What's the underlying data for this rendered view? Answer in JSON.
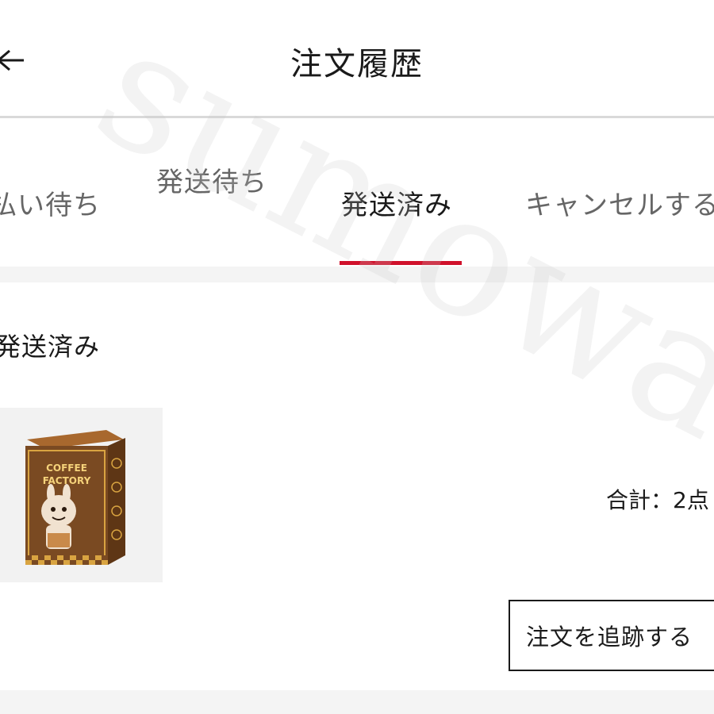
{
  "header": {
    "title": "注文履歴",
    "back_icon": "arrow-left-icon"
  },
  "tabs": [
    {
      "label": "支払い待ち",
      "visible_text": "払い待ち",
      "active": false
    },
    {
      "label": "発送待ち",
      "active": false
    },
    {
      "label": "発送済み",
      "active": true
    },
    {
      "label": "キャンセルする",
      "visible_text": "キャンセルする",
      "active": false
    }
  ],
  "order": {
    "status": "発送済み",
    "product_image": "product-box-image",
    "product_box_text": "COFFEE FACTORY",
    "total": "合計：2点",
    "track_button": "注文を追跡する"
  },
  "watermark": {
    "text": "sumowa"
  },
  "colors": {
    "accent": "#d0112b",
    "tab_inactive": "#666666",
    "text": "#1a1a1a",
    "band": "#f4f4f4"
  }
}
